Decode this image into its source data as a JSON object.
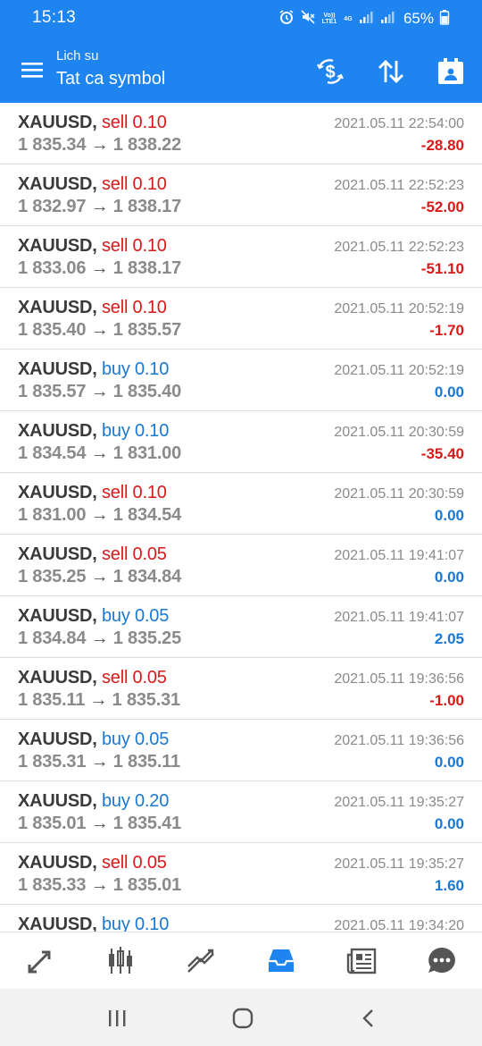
{
  "status_bar": {
    "time": "15:13",
    "net_label": "Vo)) LTE1",
    "net_type": "4G",
    "battery": "65%"
  },
  "app_bar": {
    "subtitle": "Lich su",
    "title": "Tat ca symbol",
    "icons": [
      "menu-icon",
      "currency-exchange-icon",
      "sort-icon",
      "calendar-icon"
    ]
  },
  "trades": [
    {
      "symbol": "XAUUSD,",
      "side": "sell 0.10",
      "type": "sell",
      "open": "1 835.34",
      "close": "1 838.22",
      "time": "2021.05.11 22:54:00",
      "profit": "-28.80",
      "sign": "neg"
    },
    {
      "symbol": "XAUUSD,",
      "side": "sell 0.10",
      "type": "sell",
      "open": "1 832.97",
      "close": "1 838.17",
      "time": "2021.05.11 22:52:23",
      "profit": "-52.00",
      "sign": "neg"
    },
    {
      "symbol": "XAUUSD,",
      "side": "sell 0.10",
      "type": "sell",
      "open": "1 833.06",
      "close": "1 838.17",
      "time": "2021.05.11 22:52:23",
      "profit": "-51.10",
      "sign": "neg"
    },
    {
      "symbol": "XAUUSD,",
      "side": "sell 0.10",
      "type": "sell",
      "open": "1 835.40",
      "close": "1 835.57",
      "time": "2021.05.11 20:52:19",
      "profit": "-1.70",
      "sign": "neg"
    },
    {
      "symbol": "XAUUSD,",
      "side": "buy 0.10",
      "type": "buy",
      "open": "1 835.57",
      "close": "1 835.40",
      "time": "2021.05.11 20:52:19",
      "profit": "0.00",
      "sign": "pos"
    },
    {
      "symbol": "XAUUSD,",
      "side": "buy 0.10",
      "type": "buy",
      "open": "1 834.54",
      "close": "1 831.00",
      "time": "2021.05.11 20:30:59",
      "profit": "-35.40",
      "sign": "neg"
    },
    {
      "symbol": "XAUUSD,",
      "side": "sell 0.10",
      "type": "sell",
      "open": "1 831.00",
      "close": "1 834.54",
      "time": "2021.05.11 20:30:59",
      "profit": "0.00",
      "sign": "pos"
    },
    {
      "symbol": "XAUUSD,",
      "side": "sell 0.05",
      "type": "sell",
      "open": "1 835.25",
      "close": "1 834.84",
      "time": "2021.05.11 19:41:07",
      "profit": "0.00",
      "sign": "pos"
    },
    {
      "symbol": "XAUUSD,",
      "side": "buy 0.05",
      "type": "buy",
      "open": "1 834.84",
      "close": "1 835.25",
      "time": "2021.05.11 19:41:07",
      "profit": "2.05",
      "sign": "pos"
    },
    {
      "symbol": "XAUUSD,",
      "side": "sell 0.05",
      "type": "sell",
      "open": "1 835.11",
      "close": "1 835.31",
      "time": "2021.05.11 19:36:56",
      "profit": "-1.00",
      "sign": "neg"
    },
    {
      "symbol": "XAUUSD,",
      "side": "buy 0.05",
      "type": "buy",
      "open": "1 835.31",
      "close": "1 835.11",
      "time": "2021.05.11 19:36:56",
      "profit": "0.00",
      "sign": "pos"
    },
    {
      "symbol": "XAUUSD,",
      "side": "buy 0.20",
      "type": "buy",
      "open": "1 835.01",
      "close": "1 835.41",
      "time": "2021.05.11 19:35:27",
      "profit": "0.00",
      "sign": "pos"
    },
    {
      "symbol": "XAUUSD,",
      "side": "sell 0.05",
      "type": "sell",
      "open": "1 835.33",
      "close": "1 835.01",
      "time": "2021.05.11 19:35:27",
      "profit": "1.60",
      "sign": "pos"
    },
    {
      "symbol": "XAUUSD,",
      "side": "buy 0.10",
      "type": "buy",
      "open": "",
      "close": "",
      "time": "2021.05.11 19:34:20",
      "profit": "",
      "sign": "pos"
    }
  ],
  "tab_bar": {
    "tabs": [
      "quotes-tab",
      "chart-tab",
      "trade-tab",
      "history-tab",
      "news-tab",
      "chat-tab"
    ],
    "active": "history-tab"
  },
  "colors": {
    "primary": "#1e84f0",
    "sell": "#d81a1a",
    "buy": "#1a78d2",
    "muted": "#8a8a8a"
  }
}
